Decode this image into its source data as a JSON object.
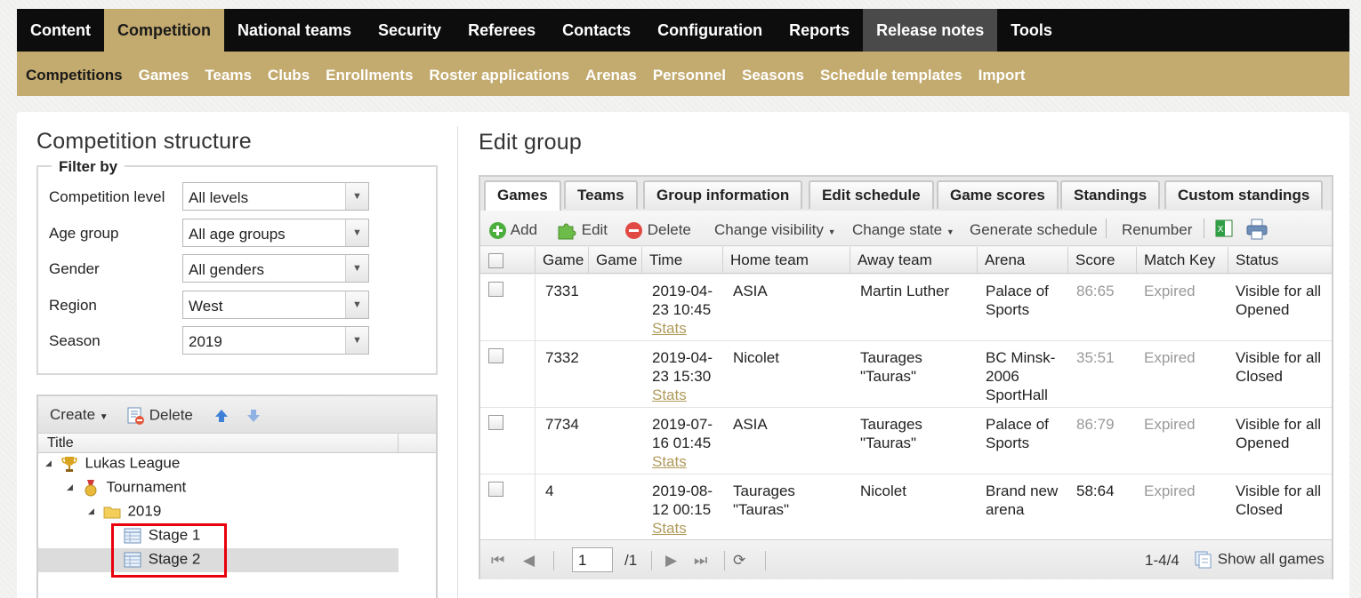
{
  "topnav": [
    "Content",
    "Competition",
    "National teams",
    "Security",
    "Referees",
    "Contacts",
    "Configuration",
    "Reports",
    "Release notes",
    "Tools"
  ],
  "subnav": [
    "Competitions",
    "Games",
    "Teams",
    "Clubs",
    "Enrollments",
    "Roster applications",
    "Arenas",
    "Personnel",
    "Seasons",
    "Schedule templates",
    "Import"
  ],
  "left": {
    "title": "Competition structure",
    "filter_legend": "Filter by",
    "filters": [
      {
        "label": "Competition level",
        "value": "All levels"
      },
      {
        "label": "Age group",
        "value": "All age groups"
      },
      {
        "label": "Gender",
        "value": "All genders"
      },
      {
        "label": "Region",
        "value": "West"
      },
      {
        "label": "Season",
        "value": "2019"
      }
    ],
    "tree_toolbar": {
      "create": "Create",
      "delete": "Delete"
    },
    "tree_header": "Title",
    "tree": [
      {
        "label": "Lukas League",
        "icon": "trophy-icon"
      },
      {
        "label": "Tournament",
        "icon": "medal-icon"
      },
      {
        "label": "2019",
        "icon": "folder-icon"
      },
      {
        "label": "Stage 1",
        "icon": "table-icon"
      },
      {
        "label": "Stage 2",
        "icon": "table-icon"
      }
    ]
  },
  "right": {
    "title": "Edit group",
    "tabs": [
      "Games",
      "Teams",
      "Group information",
      "Edit schedule",
      "Game scores",
      "Standings",
      "Custom standings"
    ],
    "toolbar": {
      "add": "Add",
      "edit": "Edit",
      "delete": "Delete",
      "change_visibility": "Change visibility",
      "change_state": "Change state",
      "generate_schedule": "Generate schedule",
      "renumber": "Renumber"
    },
    "columns": [
      "Game n",
      "Game c",
      "Time",
      "Home team",
      "Away team",
      "Arena",
      "Score",
      "Match Key",
      "Status"
    ],
    "rows": [
      {
        "num": "7331",
        "time1": "2019-04-",
        "time2": "23 10:45",
        "stats": "Stats",
        "home1": "ASIA",
        "home2": "",
        "away1": "Martin Luther",
        "away2": "",
        "arena1": "Palace of",
        "arena2": "Sports",
        "arena3": "",
        "score": "86:65",
        "score_muted": true,
        "key": "Expired",
        "status1": "Visible for all",
        "status2": "Opened"
      },
      {
        "num": "7332",
        "time1": "2019-04-",
        "time2": "23 15:30",
        "stats": "Stats",
        "home1": "Nicolet",
        "home2": "",
        "away1": "Taurages",
        "away2": "\"Tauras\"",
        "arena1": "BC Minsk-",
        "arena2": "2006",
        "arena3": "SportHall",
        "score": "35:51",
        "score_muted": true,
        "key": "Expired",
        "status1": "Visible for all",
        "status2": "Closed"
      },
      {
        "num": "7734",
        "time1": "2019-07-",
        "time2": "16 01:45",
        "stats": "Stats",
        "home1": "ASIA",
        "home2": "",
        "away1": "Taurages",
        "away2": "\"Tauras\"",
        "arena1": "Palace of",
        "arena2": "Sports",
        "arena3": "",
        "score": "86:79",
        "score_muted": true,
        "key": "Expired",
        "status1": "Visible for all",
        "status2": "Opened"
      },
      {
        "num": "4",
        "time1": "2019-08-",
        "time2": "12 00:15",
        "stats": "Stats",
        "home1": "Taurages",
        "home2": "\"Tauras\"",
        "away1": "Nicolet",
        "away2": "",
        "arena1": "Brand new",
        "arena2": "arena",
        "arena3": "",
        "score": "58:64",
        "score_muted": false,
        "key": "Expired",
        "status1": "Visible for all",
        "status2": "Closed"
      }
    ],
    "pager": {
      "page": "1",
      "total": "/1",
      "range": "1-4/4",
      "show_all": "Show all games"
    }
  },
  "colors": {
    "accent": "#c3aa6e",
    "nav_bg": "#0d0d0d",
    "highlight": "#e8000d"
  }
}
